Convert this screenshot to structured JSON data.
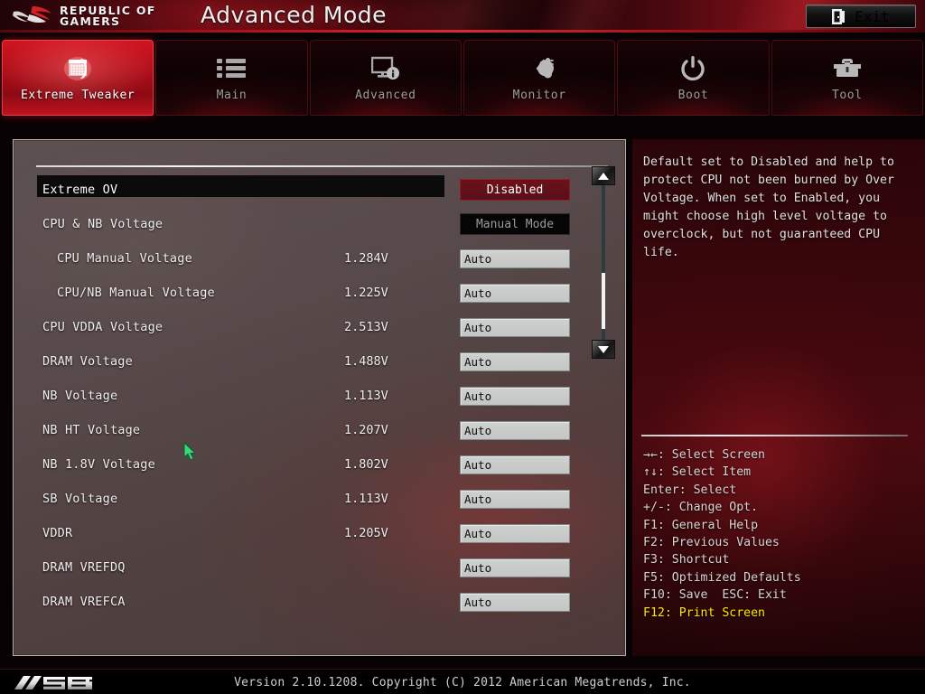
{
  "header": {
    "brand_line1": "REPUBLIC OF",
    "brand_line2": "GAMERS",
    "title": "Advanced Mode",
    "exit_label": "Exit",
    "exit_icon": "exit-door-icon",
    "accent_red": "#b00f1a"
  },
  "nav": {
    "tabs": [
      {
        "label": "Extreme Tweaker",
        "icon": "cpu-chip-icon",
        "active": true
      },
      {
        "label": "Main",
        "icon": "list-icon",
        "active": false
      },
      {
        "label": "Advanced",
        "icon": "monitor-info-icon",
        "active": false
      },
      {
        "label": "Monitor",
        "icon": "gauge-thermometer-icon",
        "active": false
      },
      {
        "label": "Boot",
        "icon": "power-icon",
        "active": false
      },
      {
        "label": "Tool",
        "icon": "toolbox-icon",
        "active": false
      }
    ]
  },
  "settings": {
    "rows": [
      {
        "label": "Extreme OV",
        "indent": 0,
        "measure": "",
        "value": "Disabled",
        "style": "pill-red",
        "selected": true
      },
      {
        "label": "CPU & NB Voltage",
        "indent": 0,
        "measure": "",
        "value": "Manual Mode",
        "style": "pill-dark",
        "selected": false
      },
      {
        "label": "CPU Manual Voltage",
        "indent": 2,
        "measure": "1.284V",
        "value": "Auto",
        "style": "field",
        "selected": false
      },
      {
        "label": "CPU/NB Manual Voltage",
        "indent": 2,
        "measure": "1.225V",
        "value": "Auto",
        "style": "field",
        "selected": false
      },
      {
        "label": "CPU VDDA Voltage",
        "indent": 0,
        "measure": "2.513V",
        "value": "Auto",
        "style": "field",
        "selected": false
      },
      {
        "label": "DRAM Voltage",
        "indent": 0,
        "measure": "1.488V",
        "value": "Auto",
        "style": "field",
        "selected": false
      },
      {
        "label": "NB Voltage",
        "indent": 0,
        "measure": "1.113V",
        "value": "Auto",
        "style": "field",
        "selected": false
      },
      {
        "label": "NB HT Voltage",
        "indent": 0,
        "measure": "1.207V",
        "value": "Auto",
        "style": "field",
        "selected": false
      },
      {
        "label": "NB 1.8V Voltage",
        "indent": 0,
        "measure": "1.802V",
        "value": "Auto",
        "style": "field",
        "selected": false
      },
      {
        "label": "SB Voltage",
        "indent": 0,
        "measure": "1.113V",
        "value": "Auto",
        "style": "field",
        "selected": false
      },
      {
        "label": "VDDR",
        "indent": 0,
        "measure": "1.205V",
        "value": "Auto",
        "style": "field",
        "selected": false
      },
      {
        "label": "DRAM VREFDQ",
        "indent": 0,
        "measure": "",
        "value": "Auto",
        "style": "field",
        "selected": false
      },
      {
        "label": "DRAM VREFCA",
        "indent": 0,
        "measure": "",
        "value": "Auto",
        "style": "field",
        "selected": false
      }
    ]
  },
  "scrollbar": {
    "up_icon": "scroll-up-arrow-icon",
    "down_icon": "scroll-down-arrow-icon"
  },
  "help": {
    "text": "Default set to Disabled and help to protect CPU not been burned by Over Voltage. When set to Enabled, you might choose high level voltage to overclock, but not guaranteed CPU life.",
    "legend": [
      {
        "text": "→←: Select Screen",
        "highlight": false
      },
      {
        "text": "↑↓: Select Item",
        "highlight": false
      },
      {
        "text": "Enter: Select",
        "highlight": false
      },
      {
        "text": "+/-: Change Opt.",
        "highlight": false
      },
      {
        "text": "F1: General Help",
        "highlight": false
      },
      {
        "text": "F2: Previous Values",
        "highlight": false
      },
      {
        "text": "F3: Shortcut",
        "highlight": false
      },
      {
        "text": "F5: Optimized Defaults",
        "highlight": false
      },
      {
        "text": "F10: Save  ESC: Exit",
        "highlight": false
      },
      {
        "text": "F12: Print Screen",
        "highlight": true
      }
    ],
    "highlight_color": "#ffe800"
  },
  "footer": {
    "brand": "ASUS",
    "version_text": "Version 2.10.1208. Copyright (C) 2012 American Megatrends, Inc."
  }
}
